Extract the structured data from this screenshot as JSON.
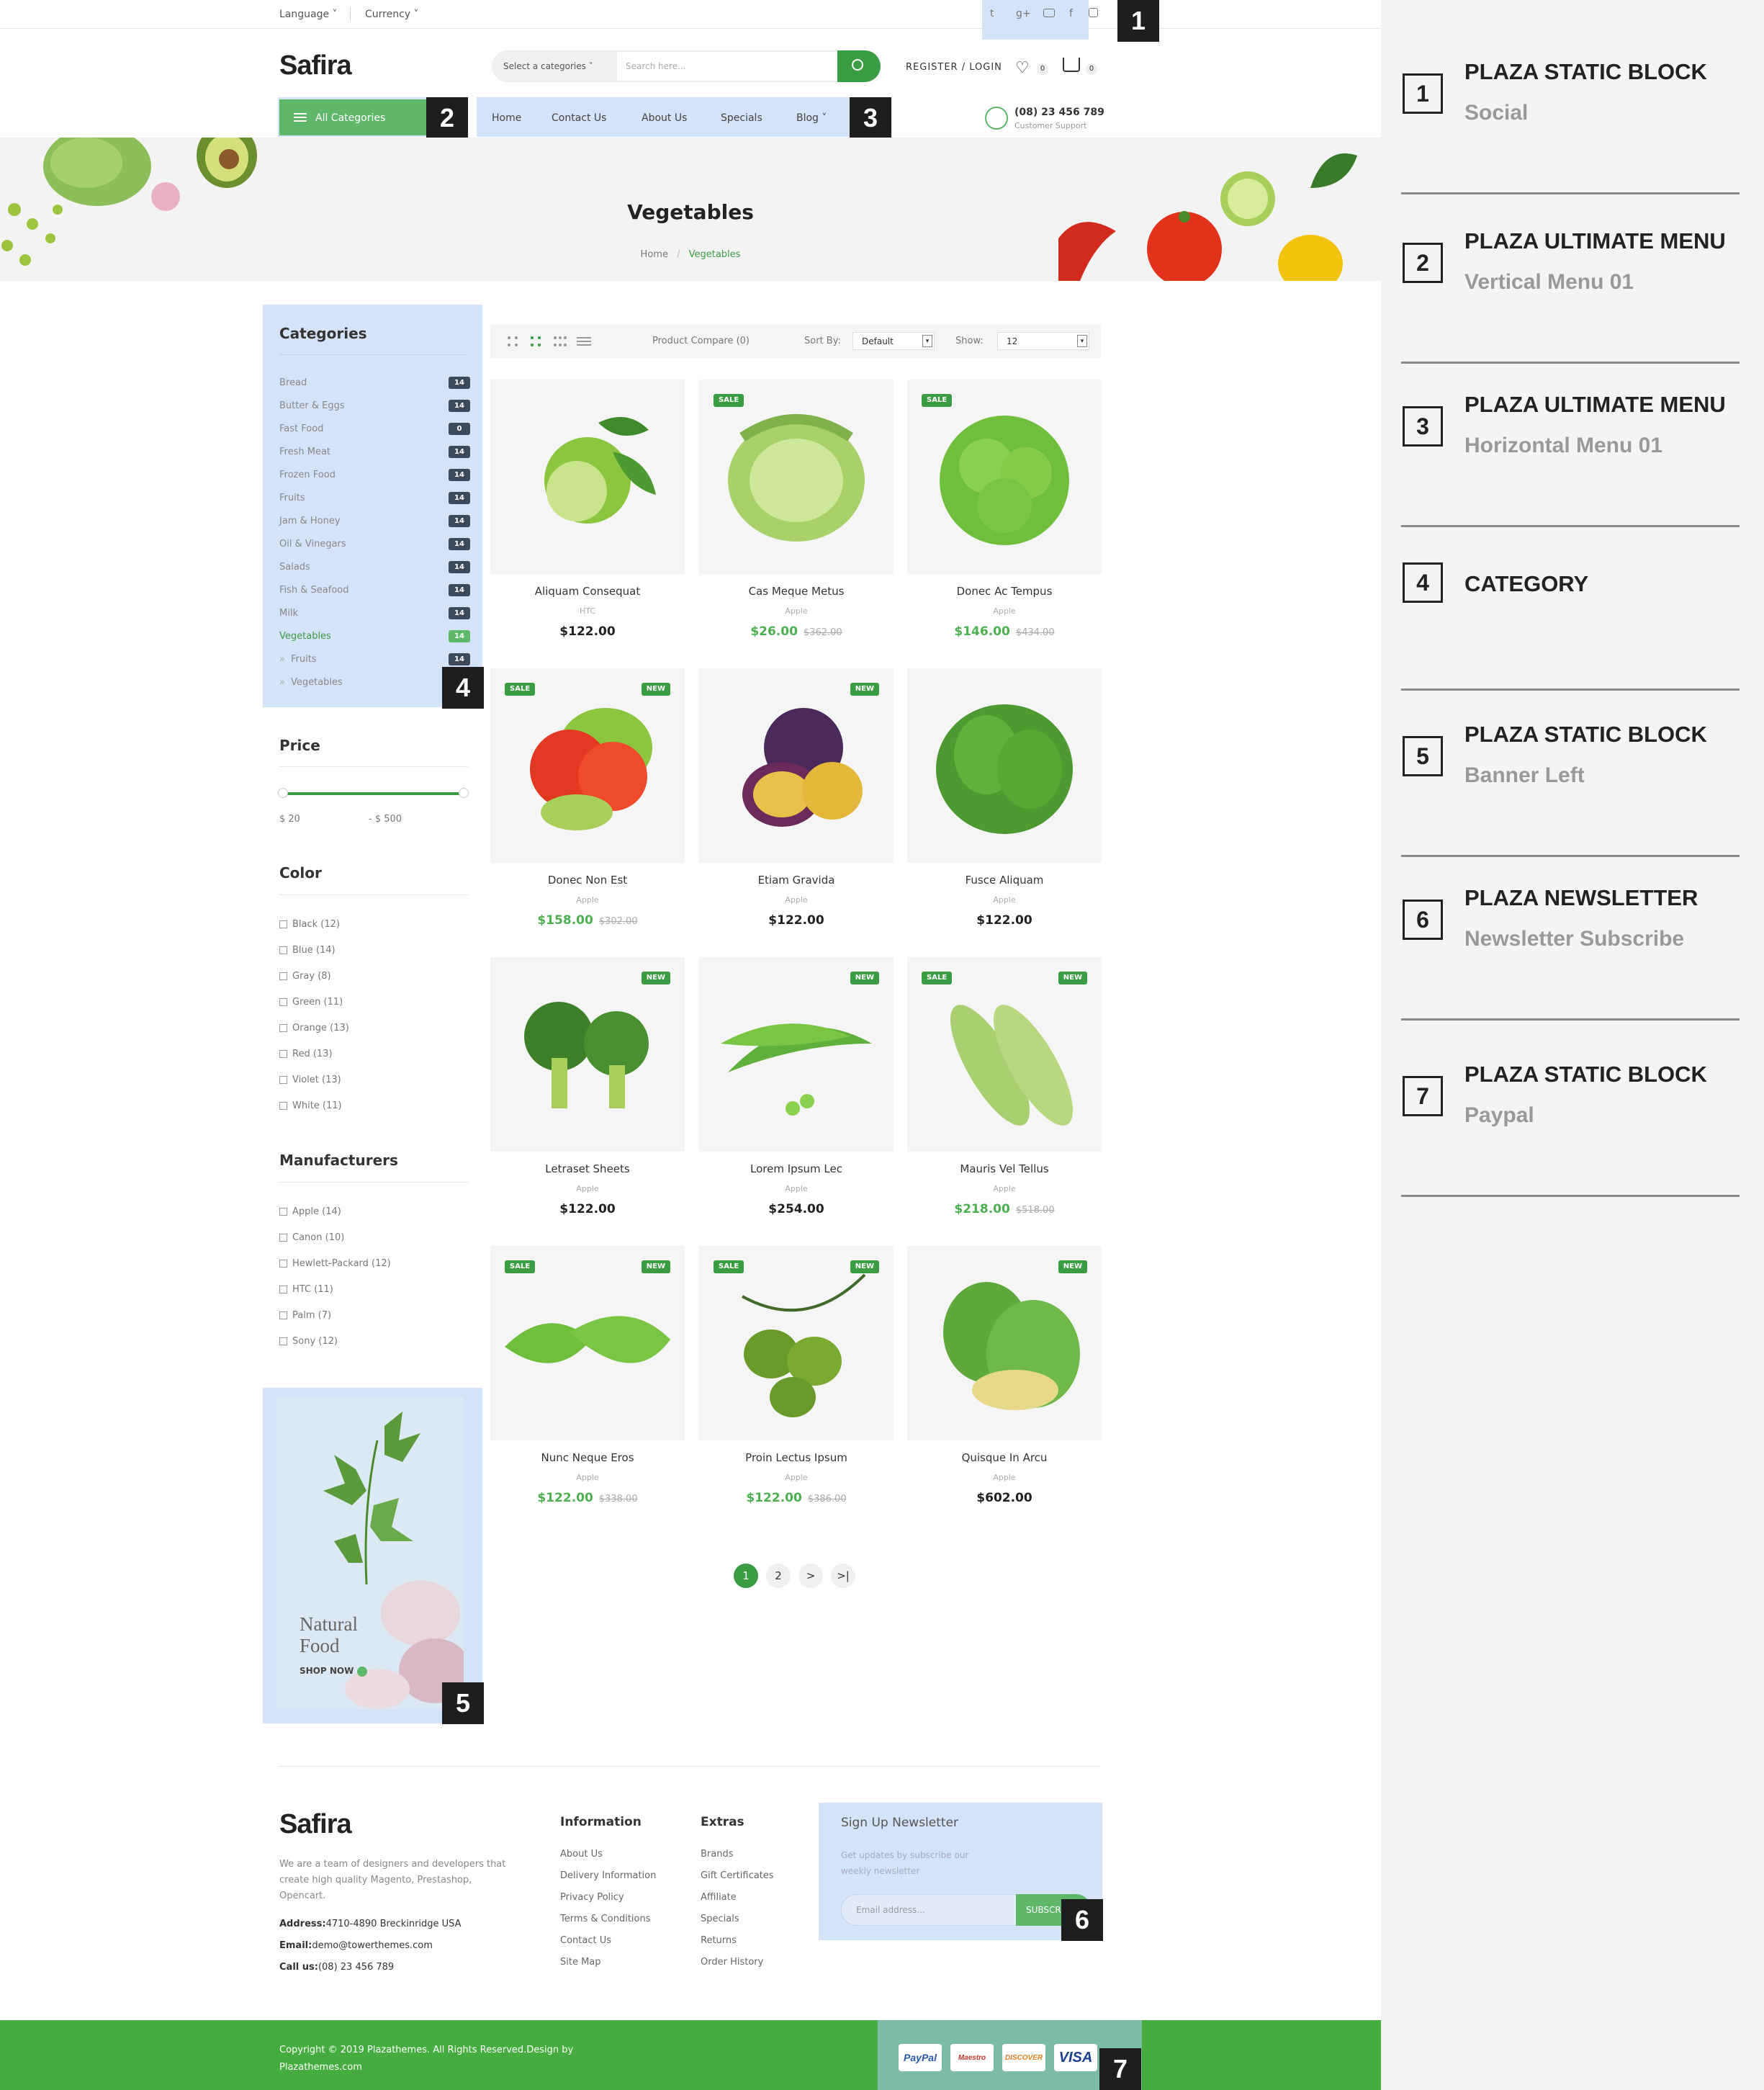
{
  "topbar": {
    "language": "Language",
    "currency": "Currency"
  },
  "header": {
    "logo": "Safira",
    "category_select": "Select a categories",
    "search_placeholder": "Search here...",
    "account": "REGISTER / LOGIN",
    "wishlist_count": "0",
    "cart_count": "0",
    "phone": "(08) 23 456 789",
    "support": "Customer Support",
    "all_categories": "All Categories"
  },
  "nav": {
    "items": [
      "Home",
      "Contact Us",
      "About Us",
      "Specials",
      "Blog"
    ]
  },
  "banner": {
    "title": "Vegetables",
    "crumb_home": "Home",
    "crumb_sep": "/",
    "crumb_current": "Vegetables"
  },
  "sidebar": {
    "categories_title": "Categories",
    "categories": [
      {
        "label": "Bread",
        "count": "14"
      },
      {
        "label": "Butter & Eggs",
        "count": "14"
      },
      {
        "label": "Fast Food",
        "count": "0"
      },
      {
        "label": "Fresh Meat",
        "count": "14"
      },
      {
        "label": "Frozen Food",
        "count": "14"
      },
      {
        "label": "Fruits",
        "count": "14"
      },
      {
        "label": "Jam & Honey",
        "count": "14"
      },
      {
        "label": "Oil & Vinegars",
        "count": "14"
      },
      {
        "label": "Salads",
        "count": "14"
      },
      {
        "label": "Fish & Seafood",
        "count": "14"
      },
      {
        "label": "Milk",
        "count": "14"
      },
      {
        "label": "Vegetables",
        "count": "14"
      },
      {
        "label": "Fruits",
        "count": "14"
      },
      {
        "label": "Vegetables",
        "count": ""
      }
    ],
    "price_title": "Price",
    "price_min": "$ 20",
    "price_max": "- $ 500",
    "price_range": [
      20,
      500
    ],
    "color_title": "Color",
    "colors": [
      "Black (12)",
      "Blue (14)",
      "Gray (8)",
      "Green (11)",
      "Orange (13)",
      "Red (13)",
      "Violet (13)",
      "White (11)"
    ],
    "manufacturers_title": "Manufacturers",
    "manufacturers": [
      "Apple (14)",
      "Canon (10)",
      "Hewlett-Packard (12)",
      "HTC (11)",
      "Palm (7)",
      "Sony (12)"
    ],
    "banner_line1": "Natural",
    "banner_line2": "Food",
    "banner_cta": "SHOP NOW"
  },
  "toolbar": {
    "compare": "Product Compare (0)",
    "sort_label": "Sort By:",
    "sort_value": "Default",
    "show_label": "Show:",
    "show_value": "12"
  },
  "products": [
    {
      "name": "Aliquam Consequat",
      "brand": "HTC",
      "price": "$122.00",
      "old": "",
      "sale": false,
      "new": false
    },
    {
      "name": "Cas Meque Metus",
      "brand": "Apple",
      "price": "$26.00",
      "old": "$362.00",
      "sale": true,
      "new": false
    },
    {
      "name": "Donec Ac Tempus",
      "brand": "Apple",
      "price": "$146.00",
      "old": "$434.00",
      "sale": true,
      "new": false
    },
    {
      "name": "Donec Non Est",
      "brand": "Apple",
      "price": "$158.00",
      "old": "$302.00",
      "sale": true,
      "new": true
    },
    {
      "name": "Etiam Gravida",
      "brand": "Apple",
      "price": "$122.00",
      "old": "",
      "sale": false,
      "new": true
    },
    {
      "name": "Fusce Aliquam",
      "brand": "Apple",
      "price": "$122.00",
      "old": "",
      "sale": false,
      "new": false
    },
    {
      "name": "Letraset Sheets",
      "brand": "Apple",
      "price": "$122.00",
      "old": "",
      "sale": false,
      "new": true
    },
    {
      "name": "Lorem Ipsum Lec",
      "brand": "Apple",
      "price": "$254.00",
      "old": "",
      "sale": false,
      "new": true
    },
    {
      "name": "Mauris Vel Tellus",
      "brand": "Apple",
      "price": "$218.00",
      "old": "$518.00",
      "sale": true,
      "new": true
    },
    {
      "name": "Nunc Neque Eros",
      "brand": "Apple",
      "price": "$122.00",
      "old": "$338.00",
      "sale": true,
      "new": true
    },
    {
      "name": "Proin Lectus Ipsum",
      "brand": "Apple",
      "price": "$122.00",
      "old": "$386.00",
      "sale": true,
      "new": true
    },
    {
      "name": "Quisque In Arcu",
      "brand": "Apple",
      "price": "$602.00",
      "old": "",
      "sale": false,
      "new": true
    }
  ],
  "product_labels": {
    "sale": "SALE",
    "new": "NEW"
  },
  "pagination": [
    "1",
    "2",
    ">",
    ">|"
  ],
  "footer": {
    "logo": "Safira",
    "about": [
      "We are a team of designers and developers that",
      "create high quality Magento, Prestashop,",
      "Opencart."
    ],
    "address_label": "Address:",
    "address": "4710-4890 Breckinridge USA",
    "email_label": "Email:",
    "email": "demo@towerthemes.com",
    "call_label": "Call us:",
    "call": "(08) 23 456 789",
    "info_title": "Information",
    "info_links": [
      "About Us",
      "Delivery Information",
      "Privacy Policy",
      "Terms & Conditions",
      "Contact Us",
      "Site Map"
    ],
    "extras_title": "Extras",
    "extras_links": [
      "Brands",
      "Gift Certificates",
      "Affiliate",
      "Specials",
      "Returns",
      "Order History"
    ],
    "newsletter_title": "Sign Up Newsletter",
    "newsletter_text": [
      "Get updates by subscribe our",
      "weekly newsletter"
    ],
    "newsletter_placeholder": "Email address...",
    "newsletter_button": "SUBSCRIBE",
    "copyright": [
      "Copyright © 2019 Plazathemes. All Rights Reserved.Design by",
      "Plazathemes.com"
    ],
    "payments": [
      "PayPal",
      "Maestro",
      "DISCOVER",
      "VISA"
    ]
  },
  "annotations": [
    {
      "num": "1",
      "title": "PLAZA STATIC BLOCK",
      "sub": "Social"
    },
    {
      "num": "2",
      "title": "PLAZA ULTIMATE MENU",
      "sub": "Vertical Menu 01"
    },
    {
      "num": "3",
      "title": "PLAZA ULTIMATE MENU",
      "sub": "Horizontal Menu 01"
    },
    {
      "num": "4",
      "title": "CATEGORY",
      "sub": ""
    },
    {
      "num": "5",
      "title": "PLAZA STATIC BLOCK",
      "sub": "Banner Left"
    },
    {
      "num": "6",
      "title": "PLAZA NEWSLETTER",
      "sub": "Newsletter Subscribe"
    },
    {
      "num": "7",
      "title": "PLAZA STATIC BLOCK",
      "sub": "Paypal"
    }
  ],
  "colors": {
    "brand_green": "#3a9d43",
    "highlight": "#d5e3f8",
    "panel_bg": "#f4f4f4"
  }
}
